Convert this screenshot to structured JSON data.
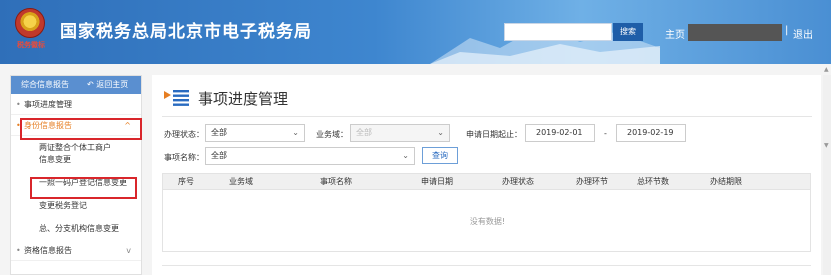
{
  "header": {
    "emblem_text": "税务徽标",
    "title": "国家税务总局北京市电子税务局",
    "search_button": "搜索",
    "home_label": "主页",
    "separator": "|",
    "logout_label": "退出"
  },
  "sidebar": {
    "head_label": "综合信息报告",
    "back_label": "返回主页",
    "items": [
      {
        "label": "事项进度管理"
      },
      {
        "label": "身份信息报告",
        "chevron": "^"
      },
      {
        "label": "两证整合个体工商户信息变更"
      },
      {
        "label": "一照一码户登记信息变更"
      },
      {
        "label": "变更税务登记"
      },
      {
        "label": "总、分支机构信息变更"
      },
      {
        "label": "资格信息报告",
        "chevron": "v"
      }
    ]
  },
  "main": {
    "page_title": "事项进度管理",
    "status_label": "办理状态：",
    "status_value": "全部",
    "domain_label": "业务域：",
    "domain_value": "全部",
    "date_label": "申请日期起止：",
    "date_from": "2019-02-01",
    "date_dash": "-",
    "date_to": "2019-02-19",
    "name_label": "事项名称：",
    "name_value": "全部",
    "query_button": "查询",
    "table": {
      "headers": [
        "序号",
        "业务域",
        "事项名称",
        "申请日期",
        "办理状态",
        "办理环节",
        "总环节数",
        "办结期限"
      ],
      "empty_text": "没有数据!"
    }
  },
  "colors": {
    "header_blue": "#2f6fb9",
    "sidebar_head": "#5a8fd0",
    "active_orange": "#e67e22",
    "highlight_red": "#d9262b",
    "query_border": "#6d9fd8"
  }
}
